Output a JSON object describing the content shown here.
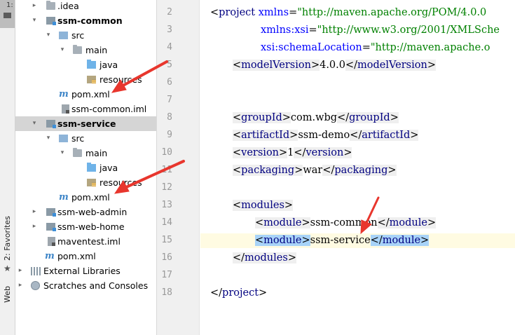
{
  "toolstrip": {
    "project_tab": "1:",
    "favorites": "2: Favorites",
    "web": "Web"
  },
  "tree": {
    "rows": [
      {
        "label": ".idea"
      },
      {
        "label": "ssm-common"
      },
      {
        "label": "src"
      },
      {
        "label": "main"
      },
      {
        "label": "java"
      },
      {
        "label": "resources"
      },
      {
        "label": "pom.xml"
      },
      {
        "label": "ssm-common.iml"
      },
      {
        "label": "ssm-service"
      },
      {
        "label": "src"
      },
      {
        "label": "main"
      },
      {
        "label": "java"
      },
      {
        "label": "resources"
      },
      {
        "label": "pom.xml"
      },
      {
        "label": "ssm-web-admin"
      },
      {
        "label": "ssm-web-home"
      },
      {
        "label": "maventest.iml"
      },
      {
        "label": "pom.xml"
      },
      {
        "label": "External Libraries"
      },
      {
        "label": "Scratches and Consoles"
      }
    ],
    "maven_mark": "m"
  },
  "gutter": {
    "line_numbers": [
      "2",
      "3",
      "4",
      "5",
      "6",
      "7",
      "8",
      "9",
      "10",
      "11",
      "12",
      "13",
      "14",
      "15",
      "16",
      "17",
      "18"
    ]
  },
  "code": {
    "l2_tag": "project",
    "l2_attr": "xmlns",
    "l2_val": "\"http://maven.apache.org/POM/4.0.0",
    "l3_attr": "xmlns:xsi",
    "l3_val": "\"http://www.w3.org/2001/XMLSche",
    "l4_attr": "xsi:schemaLocation",
    "l4_val": "\"http://maven.apache.o",
    "l5_tag": "modelVersion",
    "l5_text": "4.0.0",
    "l8_tag": "groupId",
    "l8_text": "com.wbg",
    "l9_tag": "artifactId",
    "l9_text": "ssm-demo",
    "l10_tag": "version",
    "l10_text": "1",
    "l11_tag": "packaging",
    "l11_text": "war",
    "l13_tag": "modules",
    "l14_tag": "module",
    "l14_text": "ssm-common",
    "l15_tag": "module",
    "l15_text": "ssm-service",
    "l16_tag": "modules",
    "l18_tag": "project"
  },
  "colors": {
    "tag": "#000080",
    "attribute": "#0000ff",
    "string": "#008000",
    "annotation_arrow": "#e8362d"
  }
}
